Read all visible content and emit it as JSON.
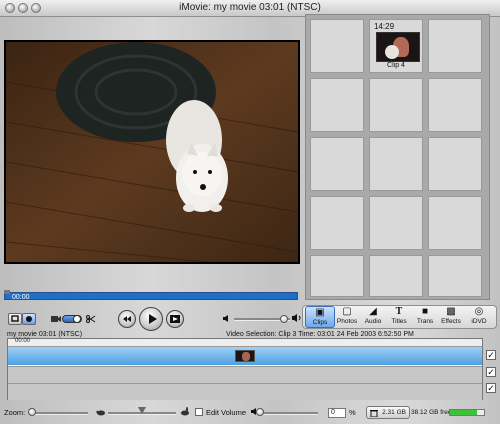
{
  "window": {
    "title": "iMovie: my movie  03:01 (NTSC)"
  },
  "monitor": {
    "timecode": "00:00"
  },
  "clips_pane": {
    "clips": [
      {
        "duration": "14:29",
        "name": "Clip 4"
      }
    ]
  },
  "pane_tabs": [
    {
      "label": "Clips",
      "icon": "clips-icon",
      "active": true
    },
    {
      "label": "Photos",
      "icon": "photo-icon"
    },
    {
      "label": "Audio",
      "icon": "speaker-icon"
    },
    {
      "label": "Titles",
      "icon": "titles-icon"
    },
    {
      "label": "Trans",
      "icon": "transition-icon"
    },
    {
      "label": "Effects",
      "icon": "effects-icon"
    },
    {
      "label": "iDVD",
      "icon": "dvd-icon"
    }
  ],
  "status": {
    "left": "my movie  03:01 (NTSC)",
    "right": "Video Selection: Clip 3  Time: 03:01  24 Feb 2003 6:52:50 PM"
  },
  "timeline": {
    "ruler_label": "00:00"
  },
  "bottom_bar": {
    "zoom_label": "Zoom:",
    "edit_volume_label": "Edit Volume",
    "volume_value": "0",
    "percent": "%",
    "disk_space": "2.31 GB",
    "free_space": "38.12 GB free",
    "free_fraction": 0.8
  },
  "colors": {
    "accent": "#1d6fc9",
    "timeline_video": "#4fa0e2",
    "free_bar": "#3ec23e"
  }
}
